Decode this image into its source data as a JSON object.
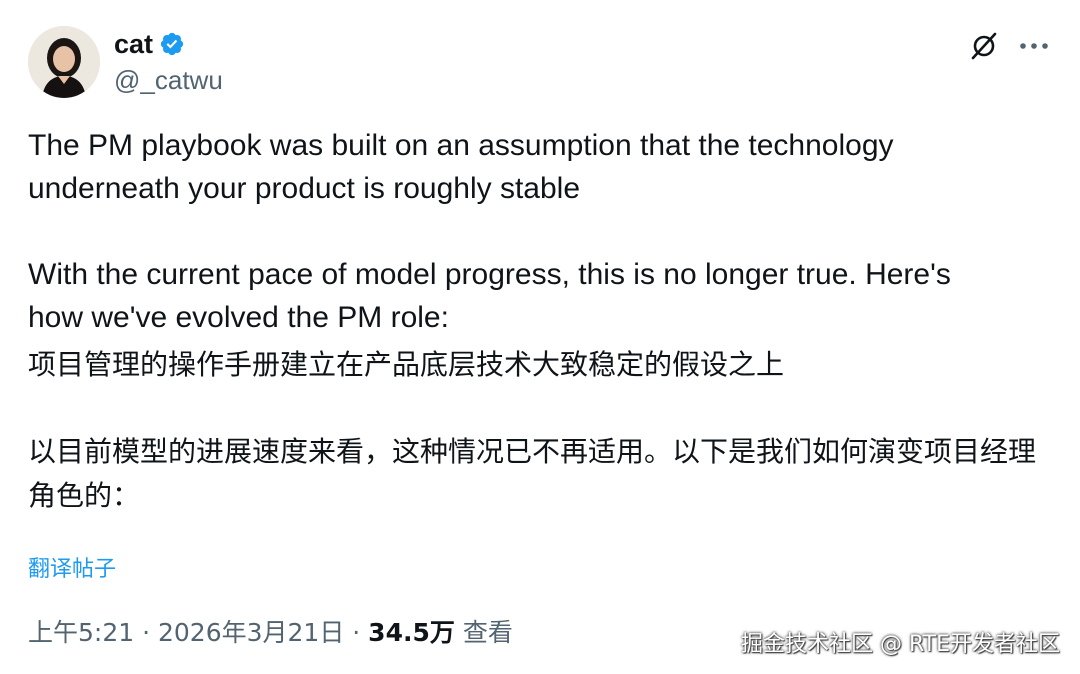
{
  "author": {
    "name": "cat",
    "handle": "@_catwu",
    "verified": true,
    "verified_color": "#1d9bf0"
  },
  "actions": {
    "grok_icon": "grok-icon",
    "more_icon": "more-icon"
  },
  "post": {
    "en_paragraph_1": "The PM playbook was built on an assumption that the technology underneath your product is roughly stable",
    "en_paragraph_2": "With the current pace of model progress, this is no longer true. Here's how we've evolved the PM role:",
    "zh_paragraph_1": "项目管理的操作手册建立在产品底层技术大致稳定的假设之上",
    "zh_paragraph_2": "以目前模型的进展速度来看，这种情况已不再适用。以下是我们如何演变项目经理角色的："
  },
  "translate_link": "翻译帖子",
  "meta": {
    "time": "上午5:21",
    "separator": " · ",
    "date": "2026年3月21日",
    "views_count": "34.5万",
    "views_label": "查看"
  },
  "watermark": "掘金技术社区 @ RTE开发者社区",
  "colors": {
    "text": "#0f1419",
    "secondary": "#536471",
    "link": "#1d9bf0"
  }
}
